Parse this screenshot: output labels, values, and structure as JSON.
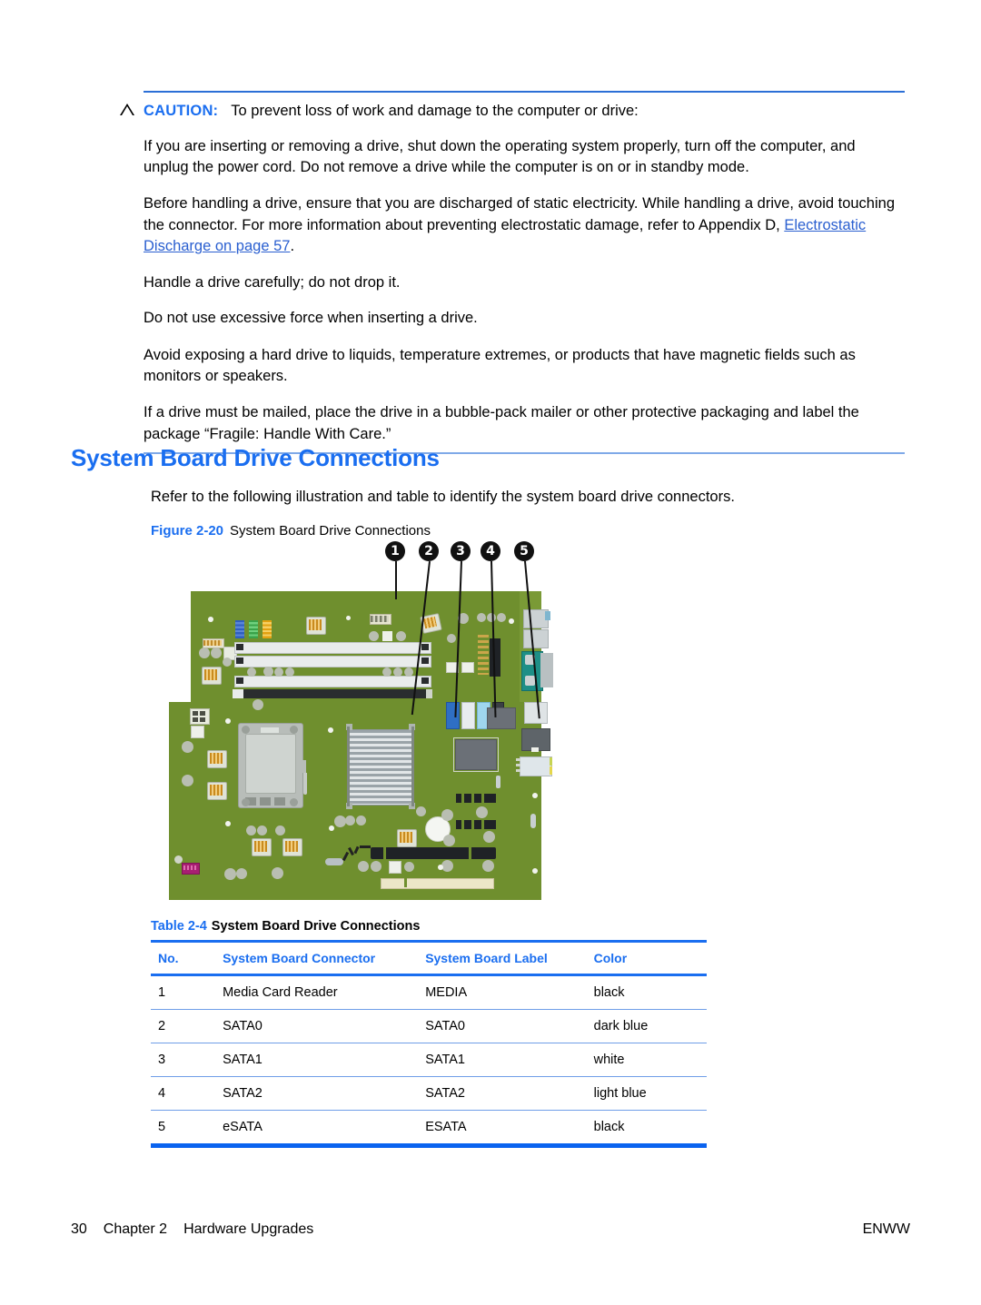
{
  "caution": {
    "icon": "caution-triangle-icon",
    "label": "CAUTION:",
    "lead": "To prevent loss of work and damage to the computer or drive:",
    "paragraphs": [
      "If you are inserting or removing a drive, shut down the operating system properly, turn off the computer, and unplug the power cord. Do not remove a drive while the computer is on or in standby mode.",
      "Handle a drive carefully; do not drop it.",
      "Do not use excessive force when inserting a drive.",
      "Avoid exposing a hard drive to liquids, temperature extremes, or products that have magnetic fields such as monitors or speakers.",
      "If a drive must be mailed, place the drive in a bubble-pack mailer or other protective packaging and label the package “Fragile: Handle With Care.”"
    ],
    "esd_paragraph": {
      "before": "Before handling a drive, ensure that you are discharged of static electricity. While handling a drive, avoid touching the connector. For more information about preventing electrostatic damage, refer to Appendix D, ",
      "link": "Electrostatic Discharge on page 57",
      "after": "."
    }
  },
  "section": {
    "heading": "System Board Drive Connections",
    "intro": "Refer to the following illustration and table to identify the system board drive connectors."
  },
  "figure": {
    "number": "Figure 2-20",
    "title": "System Board Drive Connections",
    "callouts": [
      "1",
      "2",
      "3",
      "4",
      "5"
    ],
    "connector_colors": {
      "sata0": "#2f6fc4",
      "sata1": "#e8ecef",
      "sata2": "#9fd6ee",
      "esata": "#3a3f44"
    },
    "pcb_color": "#6f8f2e"
  },
  "table": {
    "number": "Table 2-4",
    "title": "System Board Drive Connections",
    "columns": [
      "No.",
      "System Board Connector",
      "System Board Label",
      "Color"
    ],
    "rows": [
      [
        "1",
        "Media Card Reader",
        "MEDIA",
        "black"
      ],
      [
        "2",
        "SATA0",
        "SATA0",
        "dark blue"
      ],
      [
        "3",
        "SATA1",
        "SATA1",
        "white"
      ],
      [
        "4",
        "SATA2",
        "SATA2",
        "light blue"
      ],
      [
        "5",
        "eSATA",
        "ESATA",
        "black"
      ]
    ]
  },
  "footer": {
    "page_number": "30",
    "chapter": "Chapter 2",
    "chapter_title": "Hardware Upgrades",
    "locale": "ENWW"
  },
  "colors": {
    "accent_blue": "#1a6ef0",
    "rule_blue": "#2c6fd6",
    "link_blue": "#2a5fd0"
  }
}
